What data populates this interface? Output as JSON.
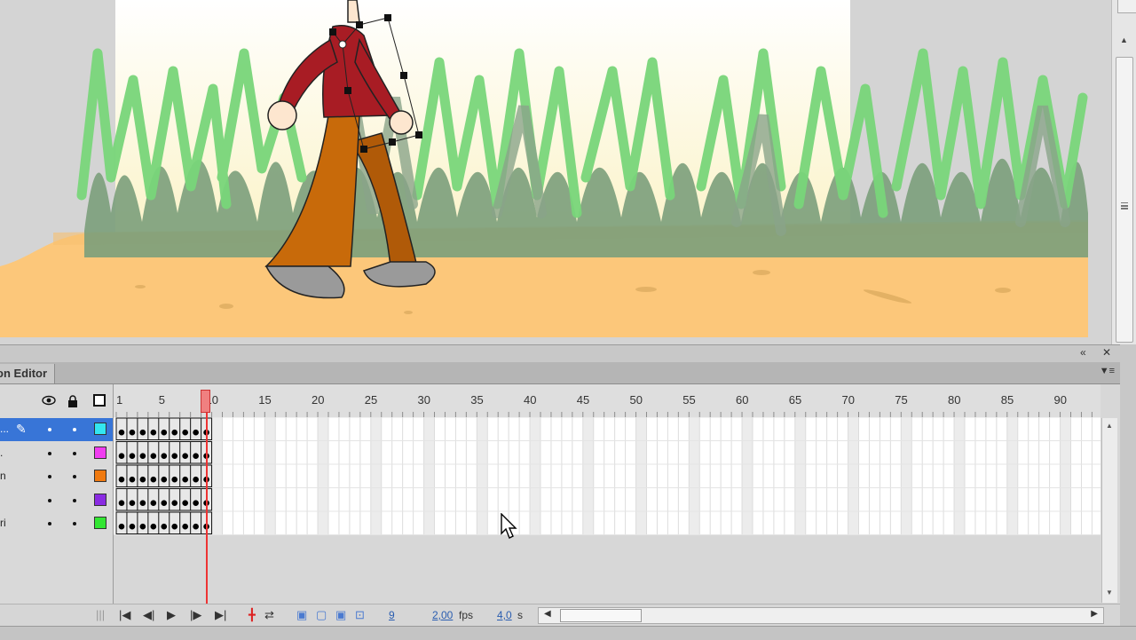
{
  "panel": {
    "title": "on Editor",
    "collapse_icon": "double-chevron-icon",
    "close_icon": "close-icon",
    "menu_icon": "panel-menu-icon"
  },
  "timeline": {
    "header_icons": [
      "eye-icon",
      "lock-icon",
      "outline-icon"
    ],
    "ruler_labels": [
      "1",
      "5",
      "10",
      "15",
      "20",
      "25",
      "30",
      "35",
      "40",
      "45",
      "50",
      "55",
      "60",
      "65",
      "70",
      "75",
      "80",
      "85",
      "90"
    ],
    "current_frame": 9,
    "layers": [
      {
        "name": "...",
        "color": "#33e6f0",
        "selected": true
      },
      {
        "name": ".",
        "color": "#f03cf0",
        "selected": false
      },
      {
        "name": "n",
        "color": "#f07a10",
        "selected": false
      },
      {
        "name": "",
        "color": "#8a2be2",
        "selected": false
      },
      {
        "name": "ri",
        "color": "#33e633",
        "selected": false
      }
    ],
    "keyframes_per_layer": 9
  },
  "bottom": {
    "frame": "9",
    "fps_value": "2,00",
    "fps_unit": "fps",
    "time_value": "4,0",
    "time_unit": "s"
  },
  "colors": {
    "ground": "#fcc77a",
    "grass_light": "#79d67a",
    "grass_dark": "#7b9f7b",
    "playhead": "#e33333",
    "selection": "#3875d7"
  }
}
